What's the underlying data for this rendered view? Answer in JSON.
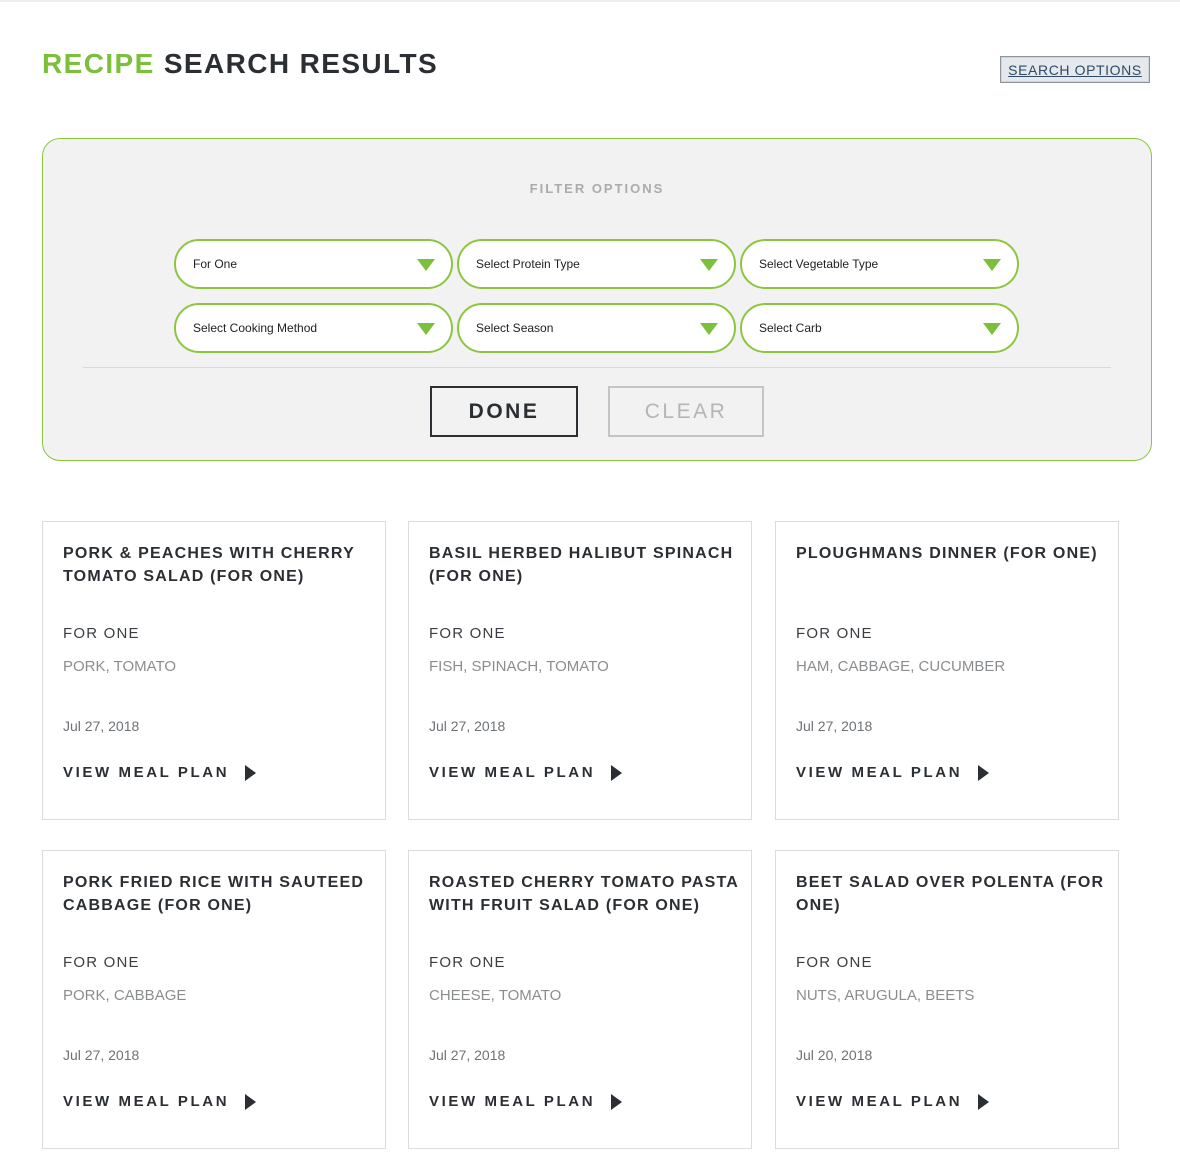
{
  "header": {
    "title_accent": "RECIPE",
    "title_rest": "SEARCH RESULTS",
    "search_options_label": "SEARCH OPTIONS"
  },
  "filters": {
    "heading": "FILTER OPTIONS",
    "selects": [
      {
        "value": "For One"
      },
      {
        "value": "Select Protein Type"
      },
      {
        "value": "Select Vegetable Type"
      },
      {
        "value": "Select Cooking Method"
      },
      {
        "value": "Select Season"
      },
      {
        "value": "Select Carb"
      }
    ],
    "done_label": "DONE",
    "clear_label": "CLEAR"
  },
  "recipes": [
    {
      "title": "PORK & PEACHES WITH CHERRY TOMATO SALAD (FOR ONE)",
      "serving": "FOR ONE",
      "ingredients": "PORK, TOMATO",
      "date": "Jul 27, 2018",
      "link": "VIEW MEAL PLAN"
    },
    {
      "title": "BASIL HERBED HALIBUT SPINACH (FOR ONE)",
      "serving": "FOR ONE",
      "ingredients": "FISH, SPINACH, TOMATO",
      "date": "Jul 27, 2018",
      "link": "VIEW MEAL PLAN"
    },
    {
      "title": "PLOUGHMANS DINNER (FOR ONE)",
      "serving": "FOR ONE",
      "ingredients": "HAM, CABBAGE, CUCUMBER",
      "date": "Jul 27, 2018",
      "link": "VIEW MEAL PLAN"
    },
    {
      "title": "PORK FRIED RICE WITH SAUTEED CABBAGE (FOR ONE)",
      "serving": "FOR ONE",
      "ingredients": "PORK, CABBAGE",
      "date": "Jul 27, 2018",
      "link": "VIEW MEAL PLAN"
    },
    {
      "title": "ROASTED CHERRY TOMATO PASTA WITH FRUIT SALAD (FOR ONE)",
      "serving": "FOR ONE",
      "ingredients": "CHEESE, TOMATO",
      "date": "Jul 27, 2018",
      "link": "VIEW MEAL PLAN"
    },
    {
      "title": "BEET SALAD OVER POLENTA (FOR ONE)",
      "serving": "FOR ONE",
      "ingredients": "NUTS, ARUGULA, BEETS",
      "date": "Jul 20, 2018",
      "link": "VIEW MEAL PLAN"
    }
  ],
  "colors": {
    "accent_green": "#7bbf3a",
    "border_green": "#8cc63f",
    "text_dark": "#2b2f33",
    "panel_bg": "#f2f2f2"
  }
}
